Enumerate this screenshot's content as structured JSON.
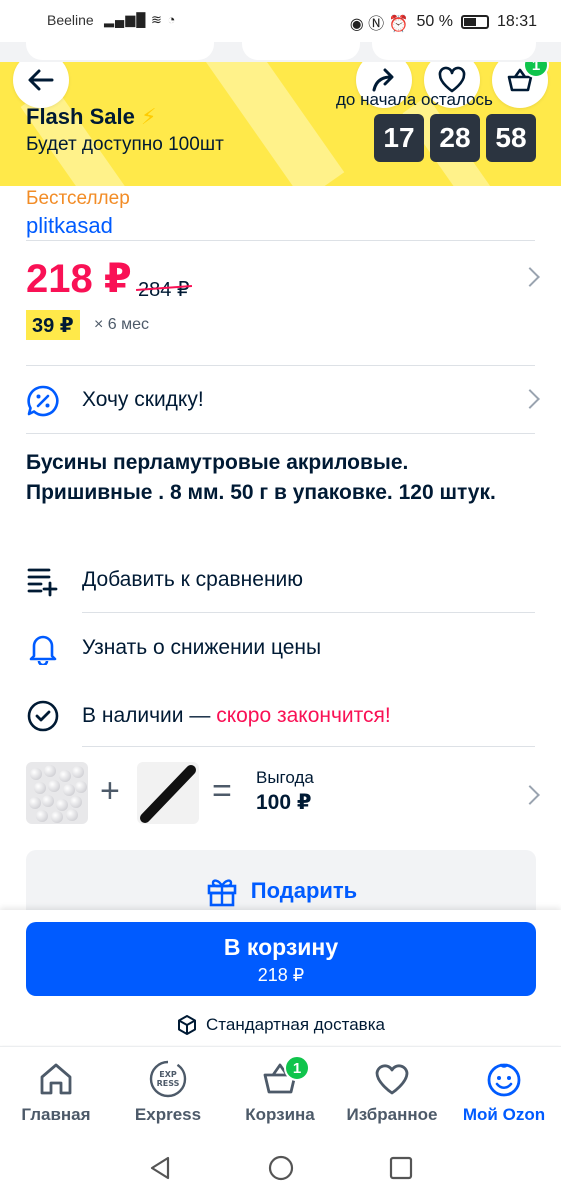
{
  "status_bar": {
    "carrier": "Beeline",
    "battery": "50 %",
    "time": "18:31"
  },
  "header": {
    "cart_count": "1"
  },
  "flash": {
    "title": "Flash Sale",
    "bolt": "⚡",
    "subtitle": "Будет доступно 100шт",
    "until_label": "до начала осталось",
    "timer": [
      "17",
      "28",
      "58"
    ]
  },
  "product": {
    "badge": "Бестселлер",
    "brand": "plitkasad",
    "price": "218 ₽",
    "old_price": "284 ₽",
    "installment": "39 ₽",
    "installment_term": "× 6 мес",
    "title": "Бусины перламутровые акриловые. Пришивные . 8 мм. 50 г в упаковке. 120 штук."
  },
  "actions": {
    "discount": "Хочу скидку!",
    "compare": "Добавить к сравнению",
    "price_alert": "Узнать о снижении цены",
    "stock_label": "В наличии —",
    "stock_warning": "скоро закончится!"
  },
  "bundle": {
    "plus": "+",
    "equals": "=",
    "gain_label": "Выгода",
    "gain_value": "100 ₽"
  },
  "gift": {
    "label": "Подарить"
  },
  "buy": {
    "label": "В корзину",
    "price": "218 ₽",
    "delivery": "Стандартная доставка"
  },
  "nav": {
    "items": [
      {
        "label": "Главная"
      },
      {
        "label": "Express"
      },
      {
        "label": "Корзина",
        "badge": "1"
      },
      {
        "label": "Избранное"
      },
      {
        "label": "Мой Ozon"
      }
    ]
  },
  "colors": {
    "accent": "#005bff",
    "sale": "#f91155",
    "flash_bg": "#ffe94a",
    "badge_green": "#10c44c"
  }
}
